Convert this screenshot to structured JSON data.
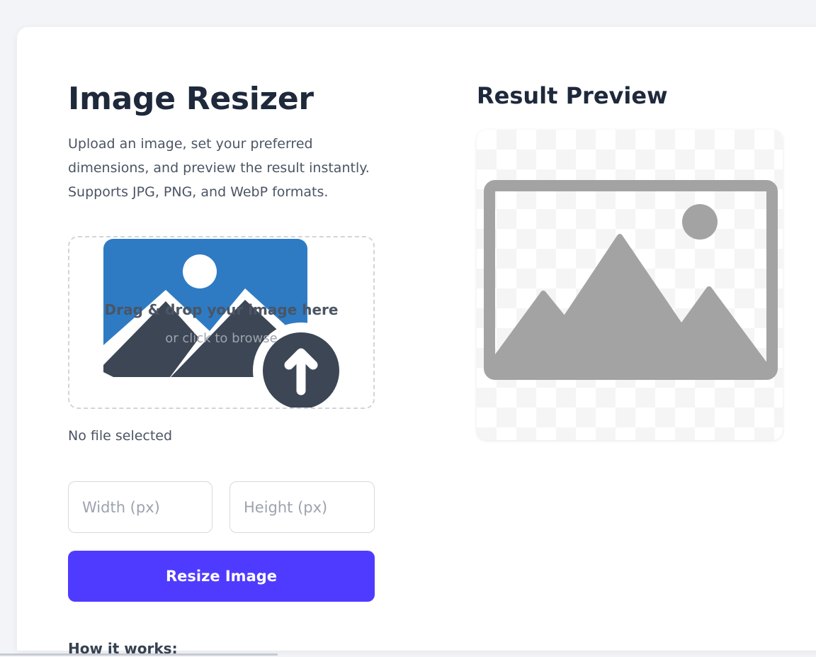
{
  "resizer": {
    "title": "Image Resizer",
    "description": "Upload an image, set your preferred dimensions, and preview the result instantly. Supports JPG, PNG, and WebP formats.",
    "dropzone": {
      "title": "Drag & drop your image here",
      "subtitle": "or click to browse",
      "icon": "image-upload-icon"
    },
    "file_status": "No file selected",
    "width_placeholder": "Width (px)",
    "height_placeholder": "Height (px)",
    "button_label": "Resize Image",
    "how_it_works": "How it works:"
  },
  "preview": {
    "title": "Result Preview",
    "icon": "image-placeholder-icon"
  },
  "colors": {
    "accent": "#4f3bff",
    "upload_blue": "#2e7bc4",
    "upload_dark": "#3d4654",
    "placeholder_gray": "#a3a3a3"
  }
}
